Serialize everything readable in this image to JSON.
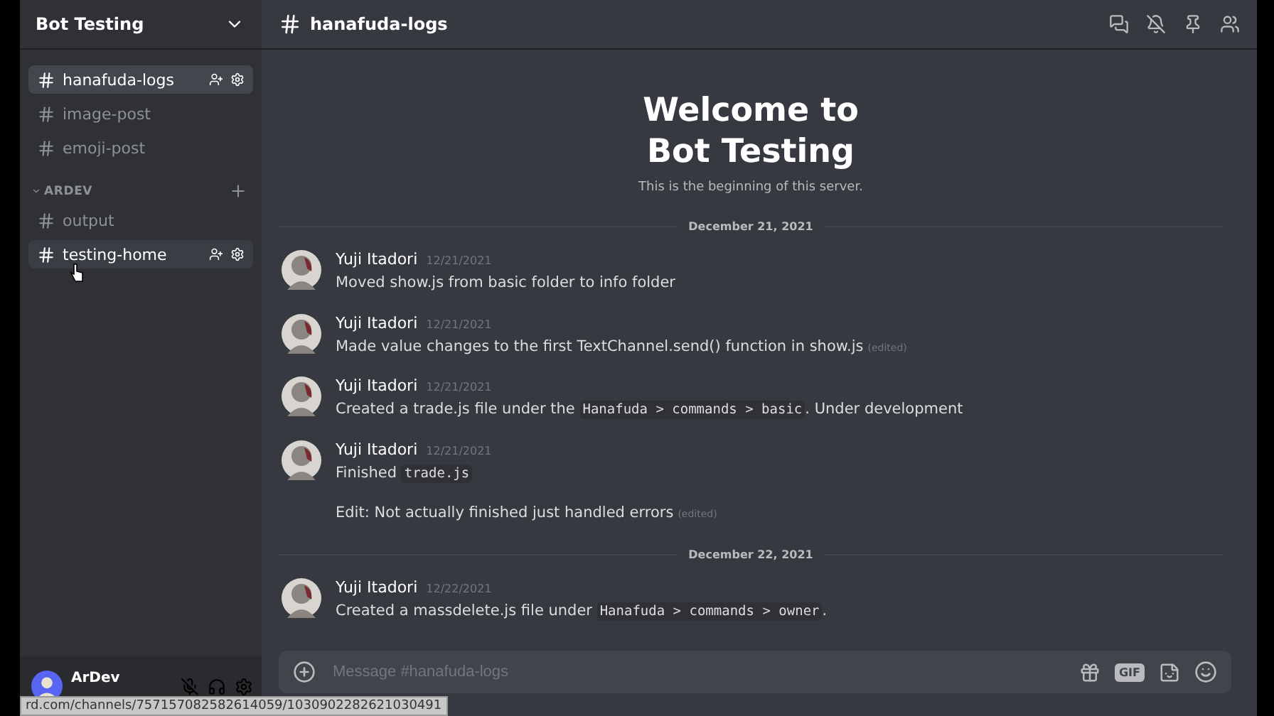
{
  "server": {
    "name": "Bot Testing"
  },
  "channels": [
    {
      "name": "hanafuda-logs",
      "selected": true,
      "hovered": false
    },
    {
      "name": "image-post",
      "selected": false,
      "hovered": false
    },
    {
      "name": "emoji-post",
      "selected": false,
      "hovered": false
    }
  ],
  "category": {
    "name": "ARDEV",
    "expanded": true,
    "channels": [
      {
        "name": "output",
        "selected": false,
        "hovered": false
      },
      {
        "name": "testing-home",
        "selected": false,
        "hovered": true
      }
    ]
  },
  "user": {
    "name": "ArDev"
  },
  "link_preview": "rd.com/channels/757157082582614059/1030902282621030491",
  "header": {
    "channel": "hanafuda-logs"
  },
  "welcome": {
    "title": "Welcome to Bot Testing",
    "subtitle": "This is the beginning of this server."
  },
  "feed": [
    {
      "kind": "divider",
      "text": "December 21, 2021"
    },
    {
      "kind": "message",
      "author": "Yuji Itadori",
      "time": "12/21/2021",
      "paragraphs": [
        [
          {
            "kind": "text",
            "text": "Moved show.js from basic folder to info folder"
          }
        ]
      ]
    },
    {
      "kind": "message",
      "author": "Yuji Itadori",
      "time": "12/21/2021",
      "paragraphs": [
        [
          {
            "kind": "text",
            "text": "Made value changes to the first TextChannel.send() function in show.js"
          }
        ]
      ],
      "edited_label": "(edited)"
    },
    {
      "kind": "message",
      "author": "Yuji Itadori",
      "time": "12/21/2021",
      "paragraphs": [
        [
          {
            "kind": "text",
            "text": "Created a trade.js file under the "
          },
          {
            "kind": "code",
            "text": "Hanafuda > commands > basic"
          },
          {
            "kind": "text",
            "text": ". Under development"
          }
        ]
      ]
    },
    {
      "kind": "message",
      "author": "Yuji Itadori",
      "time": "12/21/2021",
      "paragraphs": [
        [
          {
            "kind": "text",
            "text": "Finished "
          },
          {
            "kind": "code",
            "text": "trade.js"
          }
        ],
        [
          {
            "kind": "text",
            "text": "Edit: Not actually finished just handled errors"
          }
        ]
      ],
      "edited_label": "(edited)"
    },
    {
      "kind": "divider",
      "text": "December 22, 2021"
    },
    {
      "kind": "message",
      "author": "Yuji Itadori",
      "time": "12/22/2021",
      "paragraphs": [
        [
          {
            "kind": "text",
            "text": "Created a massdelete.js file under "
          },
          {
            "kind": "code",
            "text": "Hanafuda > commands > owner"
          },
          {
            "kind": "text",
            "text": "."
          }
        ]
      ]
    }
  ],
  "composer": {
    "placeholder": "Message #hanafuda-logs",
    "gif_label": "GIF"
  }
}
